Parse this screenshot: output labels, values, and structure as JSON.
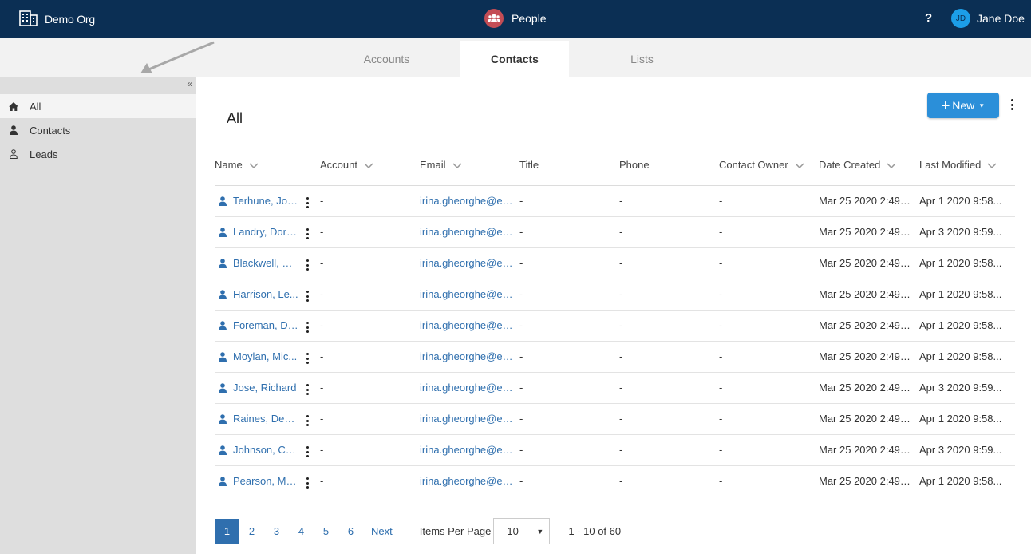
{
  "topbar": {
    "org_name": "Demo Org",
    "org_icon": "building-icon",
    "app_name": "People",
    "app_icon": "people-icon",
    "app_badge_color": "#c44d55",
    "help_label": "?",
    "user_initials": "JD",
    "user_name": "Jane Doe",
    "bg_color": "#0b2f54"
  },
  "tabs": [
    {
      "label": "Accounts",
      "active": false
    },
    {
      "label": "Contacts",
      "active": true
    },
    {
      "label": "Lists",
      "active": false
    }
  ],
  "sidebar": {
    "collapse_label": "«",
    "items": [
      {
        "label": "All",
        "icon": "home-icon",
        "active": true
      },
      {
        "label": "Contacts",
        "icon": "person-filled-icon",
        "active": false
      },
      {
        "label": "Leads",
        "icon": "person-outline-icon",
        "active": false
      }
    ]
  },
  "main": {
    "title": "All",
    "new_button": {
      "plus": "+",
      "label": "New",
      "caret": "▼",
      "color": "#2b8fd9"
    }
  },
  "table": {
    "columns": [
      "Name",
      "Account",
      "Email",
      "Title",
      "Phone",
      "Contact Owner",
      "Date Created",
      "Last Modified"
    ],
    "rows": [
      {
        "name": "Terhune, Jor...",
        "account": "-",
        "email": "irina.gheorghe@ec...",
        "title": "-",
        "phone": "-",
        "owner": "-",
        "created": "Mar 25 2020 2:49:...",
        "modified": "Apr 1 2020 9:58..."
      },
      {
        "name": "Landry, Doro...",
        "account": "-",
        "email": "irina.gheorghe@ec...",
        "title": "-",
        "phone": "-",
        "owner": "-",
        "created": "Mar 25 2020 2:49:...",
        "modified": "Apr 3 2020 9:59..."
      },
      {
        "name": "Blackwell, Ro...",
        "account": "-",
        "email": "irina.gheorghe@ec...",
        "title": "-",
        "phone": "-",
        "owner": "-",
        "created": "Mar 25 2020 2:49:...",
        "modified": "Apr 1 2020 9:58..."
      },
      {
        "name": "Harrison, Le...",
        "account": "-",
        "email": "irina.gheorghe@ec...",
        "title": "-",
        "phone": "-",
        "owner": "-",
        "created": "Mar 25 2020 2:49:...",
        "modified": "Apr 1 2020 9:58..."
      },
      {
        "name": "Foreman, Da...",
        "account": "-",
        "email": "irina.gheorghe@ec...",
        "title": "-",
        "phone": "-",
        "owner": "-",
        "created": "Mar 25 2020 2:49:...",
        "modified": "Apr 1 2020 9:58..."
      },
      {
        "name": "Moylan, Mic...",
        "account": "-",
        "email": "irina.gheorghe@ec...",
        "title": "-",
        "phone": "-",
        "owner": "-",
        "created": "Mar 25 2020 2:49:...",
        "modified": "Apr 1 2020 9:58..."
      },
      {
        "name": "Jose, Richard",
        "account": "-",
        "email": "irina.gheorghe@ec...",
        "title": "-",
        "phone": "-",
        "owner": "-",
        "created": "Mar 25 2020 2:49:...",
        "modified": "Apr 3 2020 9:59..."
      },
      {
        "name": "Raines, Dennis",
        "account": "-",
        "email": "irina.gheorghe@ec...",
        "title": "-",
        "phone": "-",
        "owner": "-",
        "created": "Mar 25 2020 2:49:...",
        "modified": "Apr 1 2020 9:58..."
      },
      {
        "name": "Johnson, Chr...",
        "account": "-",
        "email": "irina.gheorghe@ec...",
        "title": "-",
        "phone": "-",
        "owner": "-",
        "created": "Mar 25 2020 2:49:...",
        "modified": "Apr 3 2020 9:59..."
      },
      {
        "name": "Pearson, Mar...",
        "account": "-",
        "email": "irina.gheorghe@ec...",
        "title": "-",
        "phone": "-",
        "owner": "-",
        "created": "Mar 25 2020 2:49:...",
        "modified": "Apr 1 2020 9:58..."
      }
    ]
  },
  "pagination": {
    "pages": [
      "1",
      "2",
      "3",
      "4",
      "5",
      "6"
    ],
    "current_page": "1",
    "next_label": "Next",
    "items_per_page_label": "Items Per Page",
    "items_per_page_value": "10",
    "range_text": "1 - 10 of 60"
  },
  "colors": {
    "link": "#2f6fae",
    "sidebar_bg": "#dedede",
    "tabstrip_bg": "#f2f2f2"
  }
}
